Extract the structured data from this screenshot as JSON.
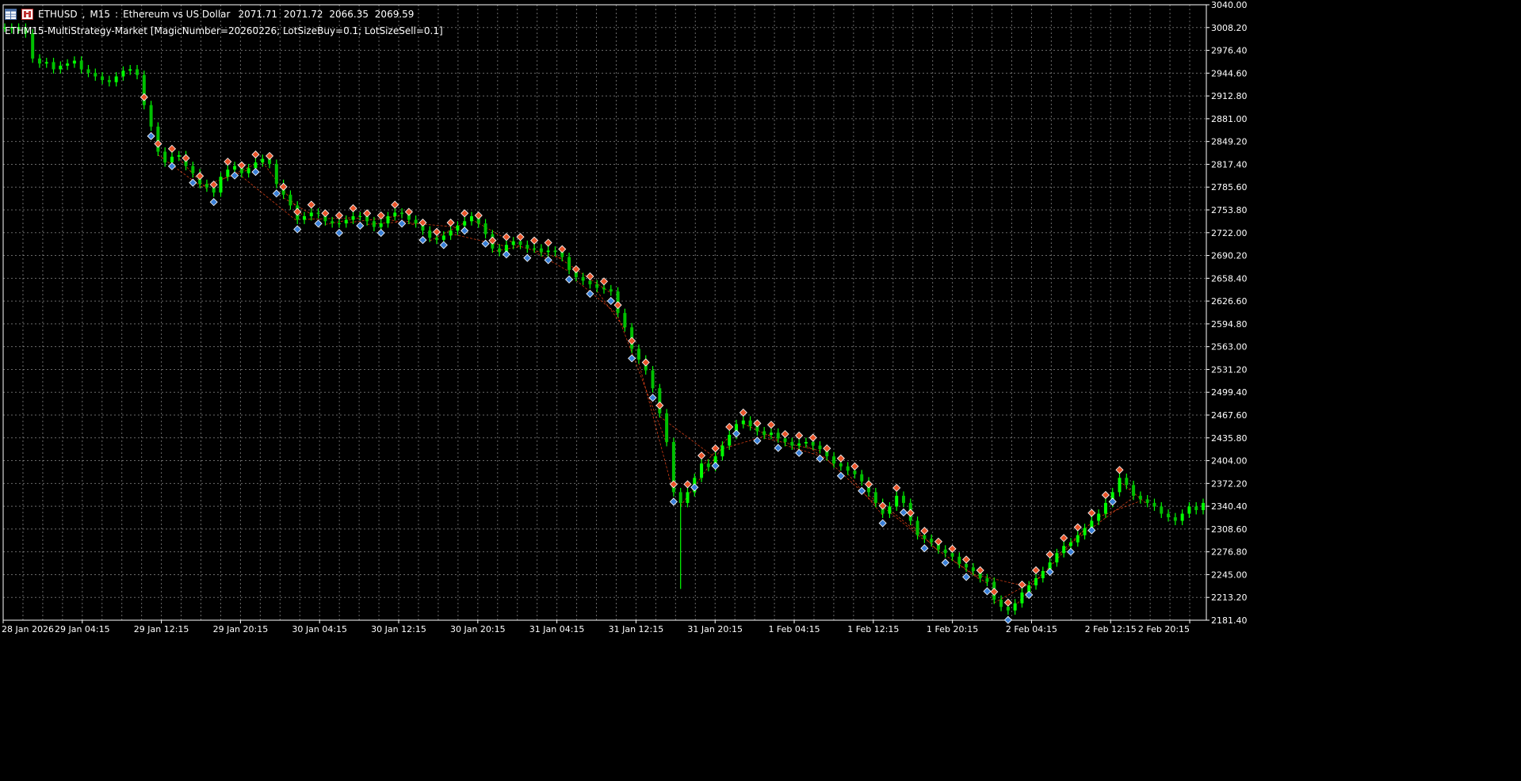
{
  "window": {
    "symbol": "ETHUSD",
    "timeframe": "M15",
    "description": "Ethereum vs US Dollar",
    "ohlc": [
      "2071.71",
      "2071.72",
      "2066.35",
      "2069.59"
    ],
    "indicator_line": "ETHM15-MultiStrategy-Market [MagicNumber=20260226; LotSizeBuy=0.1; LotSizeSell=0.1]"
  },
  "colors": {
    "background": "#000000",
    "grid": "#c0c0c0",
    "candle_bull": "#00ff00",
    "candle_bear": "#00c000",
    "axis_text": "#ffffff",
    "buy_marker": "#3a7fd6",
    "sell_marker": "#e8542a",
    "trade_line": "#ff4a1a"
  },
  "chart_data": {
    "type": "line",
    "title": "ETHUSD, M15:  Ethereum vs US Dollar",
    "y_ticks": [
      "3040.00",
      "3008.20",
      "2976.40",
      "2944.60",
      "2912.80",
      "2881.00",
      "2849.20",
      "2817.40",
      "2785.60",
      "2753.80",
      "2722.00",
      "2690.20",
      "2658.40",
      "2626.60",
      "2594.80",
      "2563.00",
      "2531.20",
      "2499.40",
      "2467.60",
      "2435.80",
      "2404.00",
      "2372.20",
      "2340.40",
      "2308.60",
      "2276.80",
      "2245.00",
      "2213.20",
      "2181.40"
    ],
    "x_ticks": [
      "28 Jan 2026",
      "29 Jan 04:15",
      "29 Jan 12:15",
      "29 Jan 20:15",
      "30 Jan 04:15",
      "30 Jan 12:15",
      "30 Jan 20:15",
      "31 Jan 04:15",
      "31 Jan 12:15",
      "31 Jan 20:15",
      "1 Feb 04:15",
      "1 Feb 12:15",
      "1 Feb 20:15",
      "2 Feb 04:15",
      "2 Feb 12:15",
      "2 Feb 20:15"
    ],
    "ylim": [
      2181.4,
      3040.0
    ],
    "grid": true,
    "series": [
      {
        "values": [
          3008,
          3006,
          3008,
          3000,
          2965,
          2958,
          2960,
          2950,
          2955,
          2958,
          2962,
          2950,
          2945,
          2940,
          2935,
          2932,
          2940,
          2948,
          2950,
          2942,
          2900,
          2870,
          2835,
          2820,
          2828,
          2830,
          2815,
          2805,
          2790,
          2785,
          2778,
          2800,
          2810,
          2815,
          2805,
          2812,
          2820,
          2825,
          2818,
          2790,
          2775,
          2760,
          2740,
          2745,
          2750,
          2748,
          2738,
          2735,
          2735,
          2740,
          2745,
          2745,
          2738,
          2730,
          2735,
          2745,
          2750,
          2748,
          2740,
          2735,
          2725,
          2715,
          2712,
          2718,
          2725,
          2732,
          2738,
          2745,
          2735,
          2720,
          2700,
          2695,
          2705,
          2710,
          2705,
          2700,
          2700,
          2695,
          2697,
          2695,
          2688,
          2670,
          2660,
          2655,
          2650,
          2645,
          2643,
          2640,
          2610,
          2590,
          2560,
          2545,
          2530,
          2505,
          2470,
          2430,
          2360,
          2345,
          2360,
          2380,
          2400,
          2395,
          2410,
          2425,
          2440,
          2455,
          2460,
          2452,
          2445,
          2440,
          2443,
          2435,
          2430,
          2425,
          2428,
          2430,
          2425,
          2420,
          2410,
          2400,
          2396,
          2390,
          2385,
          2375,
          2360,
          2345,
          2330,
          2340,
          2355,
          2345,
          2320,
          2300,
          2295,
          2290,
          2280,
          2275,
          2270,
          2260,
          2255,
          2250,
          2240,
          2235,
          2210,
          2200,
          2195,
          2205,
          2220,
          2230,
          2240,
          2250,
          2262,
          2275,
          2285,
          2290,
          2300,
          2310,
          2320,
          2330,
          2345,
          2360,
          2380,
          2370,
          2355,
          2350,
          2345,
          2340,
          2330,
          2325,
          2320,
          2330,
          2340,
          2335,
          2345
        ]
      }
    ]
  }
}
